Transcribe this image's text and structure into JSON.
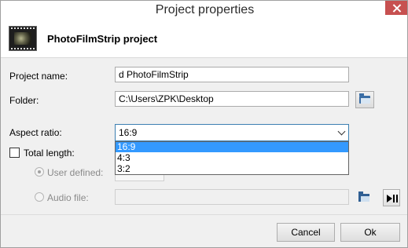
{
  "window": {
    "title": "Project properties"
  },
  "header": {
    "title": "PhotoFilmStrip project",
    "icon": "filmstrip-logo-icon"
  },
  "form": {
    "project_name_label": "Project name:",
    "project_name_value": "d PhotoFilmStrip",
    "folder_label": "Folder:",
    "folder_value": "C:\\Users\\ZPK\\Desktop",
    "aspect_label": "Aspect ratio:",
    "aspect_value": "16:9",
    "aspect_options": [
      "16:9",
      "4:3",
      "3:2"
    ],
    "total_length_label": "Total length:",
    "total_length_checked": false,
    "user_defined_label": "User defined:",
    "user_defined_selected": true,
    "audio_file_label": "Audio file:",
    "audio_file_value": ""
  },
  "buttons": {
    "cancel": "Cancel",
    "ok": "Ok"
  },
  "colors": {
    "selection": "#3399ff",
    "close": "#c75050"
  }
}
